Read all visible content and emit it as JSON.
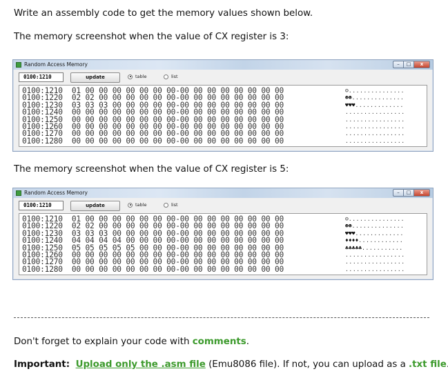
{
  "intro": "Write an assembly code to get the memory values shown below.",
  "caption1": "The memory screenshot when the value of CX register is 3:",
  "caption2": "The memory screenshot when the value of CX register is 5:",
  "window1": {
    "title": "Random Access Memory",
    "address_value": "0100:1210",
    "update_label": "update",
    "radio_table": "table",
    "radio_list": "list",
    "rows": [
      "0100:1210  01 00 00 00 00 00 00 00-00 00 00 00 00 00 00 00",
      "0100:1220  02 02 00 00 00 00 00 00-00 00 00 00 00 00 00 00",
      "0100:1230  03 03 03 00 00 00 00 00-00 00 00 00 00 00 00 00",
      "0100:1240  00 00 00 00 00 00 00 00-00 00 00 00 00 00 00 00",
      "0100:1250  00 00 00 00 00 00 00 00-00 00 00 00 00 00 00 00",
      "0100:1260  00 00 00 00 00 00 00 00-00 00 00 00 00 00 00 00",
      "0100:1270  00 00 00 00 00 00 00 00-00 00 00 00 00 00 00 00",
      "0100:1280  00 00 00 00 00 00 00 00-00 00 00 00 00 00 00 00"
    ],
    "ascii": [
      {
        "glyphs": "☺",
        "dots": "..............."
      },
      {
        "glyphs": "☻☻",
        "dots": ".............."
      },
      {
        "glyphs": "♥♥♥",
        "dots": "............."
      },
      {
        "glyphs": "",
        "dots": "................"
      },
      {
        "glyphs": "",
        "dots": "................"
      },
      {
        "glyphs": "",
        "dots": "................"
      },
      {
        "glyphs": "",
        "dots": "................"
      },
      {
        "glyphs": "",
        "dots": "................"
      }
    ]
  },
  "window2": {
    "title": "Random Access Memory",
    "address_value": "0100:1210",
    "update_label": "update",
    "radio_table": "table",
    "radio_list": "list",
    "rows": [
      "0100:1210  01 00 00 00 00 00 00 00-00 00 00 00 00 00 00 00",
      "0100:1220  02 02 00 00 00 00 00 00-00 00 00 00 00 00 00 00",
      "0100:1230  03 03 03 00 00 00 00 00-00 00 00 00 00 00 00 00",
      "0100:1240  04 04 04 04 00 00 00 00-00 00 00 00 00 00 00 00",
      "0100:1250  05 05 05 05 05 00 00 00-00 00 00 00 00 00 00 00",
      "0100:1260  00 00 00 00 00 00 00 00-00 00 00 00 00 00 00 00",
      "0100:1270  00 00 00 00 00 00 00 00-00 00 00 00 00 00 00 00",
      "0100:1280  00 00 00 00 00 00 00 00-00 00 00 00 00 00 00 00"
    ],
    "ascii": [
      {
        "glyphs": "☺",
        "dots": "..............."
      },
      {
        "glyphs": "☻☻",
        "dots": ".............."
      },
      {
        "glyphs": "♥♥♥",
        "dots": "............."
      },
      {
        "glyphs": "♦♦♦♦",
        "dots": "............"
      },
      {
        "glyphs": "♣♣♣♣♣",
        "dots": "..........."
      },
      {
        "glyphs": "",
        "dots": "................"
      },
      {
        "glyphs": "",
        "dots": "................"
      },
      {
        "glyphs": "",
        "dots": "................"
      }
    ]
  },
  "note": {
    "prefix": "Don't forget to explain your code with ",
    "link": "comments",
    "suffix": "."
  },
  "important": {
    "label": "Important:",
    "link1": "Upload only the .asm file",
    "middle": " (Emu8086 file). If not, you can upload as a ",
    "link2": ".txt file",
    "suffix": "."
  },
  "colors": {
    "link_green": "#3c9a2c",
    "titlebar": "#c7d7ea",
    "close_button": "#c7452e"
  }
}
